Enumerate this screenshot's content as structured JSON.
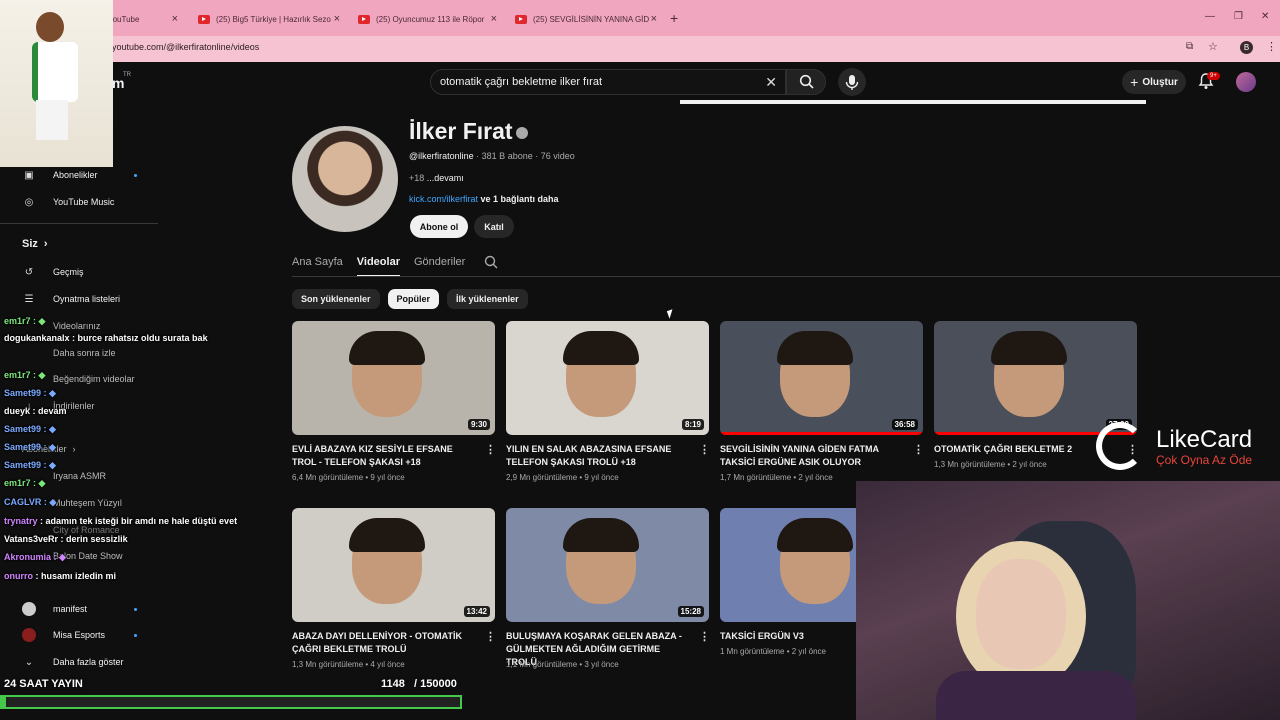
{
  "browser": {
    "tabs": [
      {
        "label": "YouTube"
      },
      {
        "label": "(25) Big5 Türkiye | Hazırlık Sezo"
      },
      {
        "label": "(25) Oyuncumuz 113 ile Röpor"
      },
      {
        "label": "(25) SEVGİLİSİNİN YANINA GİD"
      }
    ],
    "url": "youtube.com/@ilkerfiratonline/videos",
    "profile_initial": "B"
  },
  "yt": {
    "country_code": "TR",
    "search_value": "otomatik çağrı bekletme ilker fırat",
    "create_label": "Oluştur",
    "notif_count": "9+"
  },
  "channel": {
    "name": "İlker Fırat",
    "handle": "@ilkerfiratonline",
    "stats": " · 381 B abone · 76 video",
    "desc_prefix": "+18 ",
    "desc_more": "...devamı",
    "link": "kick.com/ilkerfirat",
    "link_more": " ve 1 bağlantı daha",
    "subscribe": "Abone ol",
    "join": "Katıl"
  },
  "tabs": [
    "Ana Sayfa",
    "Videolar",
    "Gönderiler"
  ],
  "chips": [
    "Son yüklenenler",
    "Popüler",
    "İlk yüklenenler"
  ],
  "videos": [
    {
      "title": "EVLİ ABAZAYA KIZ SESİYLE EFSANE TROL - TELEFON ŞAKASI +18",
      "meta": "6,4 Mn görüntüleme • 9 yıl önce",
      "duration": "9:30",
      "bg": "#b8b4ac"
    },
    {
      "title": "YILIN EN SALAK ABAZASINA EFSANE TELEFON ŞAKASI TROLÜ +18",
      "meta": "2,9 Mn görüntüleme • 9 yıl önce",
      "duration": "8:19",
      "bg": "#d9d6cf"
    },
    {
      "title": "SEVGİLİSİNİN YANINA GİDEN FATMA TAKSİCİ ERGÜNE ASIK OLUYOR",
      "meta": "1,7 Mn görüntüleme • 2 yıl önce",
      "duration": "36:58",
      "bg": "#4a4f5c"
    },
    {
      "title": "OTOMATİK ÇAĞRI BEKLETME 2",
      "meta": "1,3 Mn görüntüleme • 2 yıl önce",
      "duration": "27:00",
      "bg": "#4b4f5a"
    },
    {
      "title": "ABAZA DAYI DELLENİYOR - OTOMATİK ÇAĞRI BEKLETME TROLÜ",
      "meta": "1,3 Mn görüntüleme • 4 yıl önce",
      "duration": "13:42",
      "bg": "#cfcdc6"
    },
    {
      "title": "BULUŞMAYA KOŞARAK GELEN ABAZA - GÜLMEKTEN AĞLADIĞIM GETİRME TROLÜ",
      "meta": "1,1 Mn görüntüleme • 3 yıl önce",
      "duration": "15:28",
      "bg": "#7e8aa6"
    },
    {
      "title": "TAKSİCİ ERGÜN V3",
      "meta": "1 Mn görüntüleme • 2 yıl önce",
      "duration": "",
      "bg": "#6f7fb0"
    }
  ],
  "sidebar": {
    "items": [
      {
        "label": "Abonelikler",
        "icon": "subscriptions-icon"
      },
      {
        "label": "YouTube Music",
        "icon": "music-icon"
      },
      {
        "label": "Siz",
        "icon": ""
      },
      {
        "label": "Geçmiş",
        "icon": "history-icon"
      },
      {
        "label": "Oynatma listeleri",
        "icon": "playlist-icon"
      },
      {
        "label": "Videolarınız",
        "icon": "video-icon"
      },
      {
        "label": "Daha sonra izle",
        "icon": "clock-icon"
      },
      {
        "label": "Beğendiğim videolar",
        "icon": "like-icon"
      },
      {
        "label": "İndirilenler",
        "icon": "download-icon"
      },
      {
        "label": "Abonelikler",
        "icon": ""
      },
      {
        "label": "Iryana ASMR",
        "icon": "avatar"
      },
      {
        "label": "Muhteşem Yüzyıl",
        "icon": "avatar"
      },
      {
        "label": "City of Romance",
        "icon": "avatar"
      },
      {
        "label": "Balon Date Show",
        "icon": "avatar"
      },
      {
        "label": "manifest",
        "icon": "avatar"
      },
      {
        "label": "Misa Esports",
        "icon": "avatar"
      },
      {
        "label": "Daha fazla göster",
        "icon": "chevron-down-icon"
      }
    ]
  },
  "chat": [
    {
      "user": "em1r7",
      "msg": "",
      "color": "#7be77b"
    },
    {
      "user": "dogukankanalx",
      "msg": " : burce rahatsız oldu surata bak",
      "color": "#ffffff"
    },
    {
      "user": "em1r7",
      "msg": "",
      "color": "#7be77b"
    },
    {
      "user": "Samet99",
      "msg": "",
      "color": "#7aa9ff"
    },
    {
      "user": "dueyk",
      "msg": " : devam",
      "color": "#ffffff"
    },
    {
      "user": "Samet99",
      "msg": "",
      "color": "#7aa9ff"
    },
    {
      "user": "Samet99",
      "msg": "",
      "color": "#7aa9ff"
    },
    {
      "user": "Samet99",
      "msg": "",
      "color": "#7aa9ff"
    },
    {
      "user": "em1r7",
      "msg": "",
      "color": "#7be77b"
    },
    {
      "user": "CAGLVR",
      "msg": "",
      "color": "#7aa9ff"
    },
    {
      "user": "trynatry",
      "msg": " : adamın tek isteği bir amdı ne hale düştü evet",
      "color": "#d184ff"
    },
    {
      "user": "Vatans3veRr",
      "msg": " : derin sessizlik",
      "color": "#ffffff"
    },
    {
      "user": "Akronumia",
      "msg": "",
      "color": "#d184ff"
    },
    {
      "user": "onurro",
      "msg": " : husamı izledin mi",
      "color": "#d184ff"
    }
  ],
  "stream": {
    "label": "24 SAAT YAYIN",
    "current": "1148",
    "goal": "/ 150000",
    "progress": 0.0077
  },
  "sponsor": {
    "name": "LikeCard",
    "slogan": "Çok Oyna  Az Öde"
  }
}
